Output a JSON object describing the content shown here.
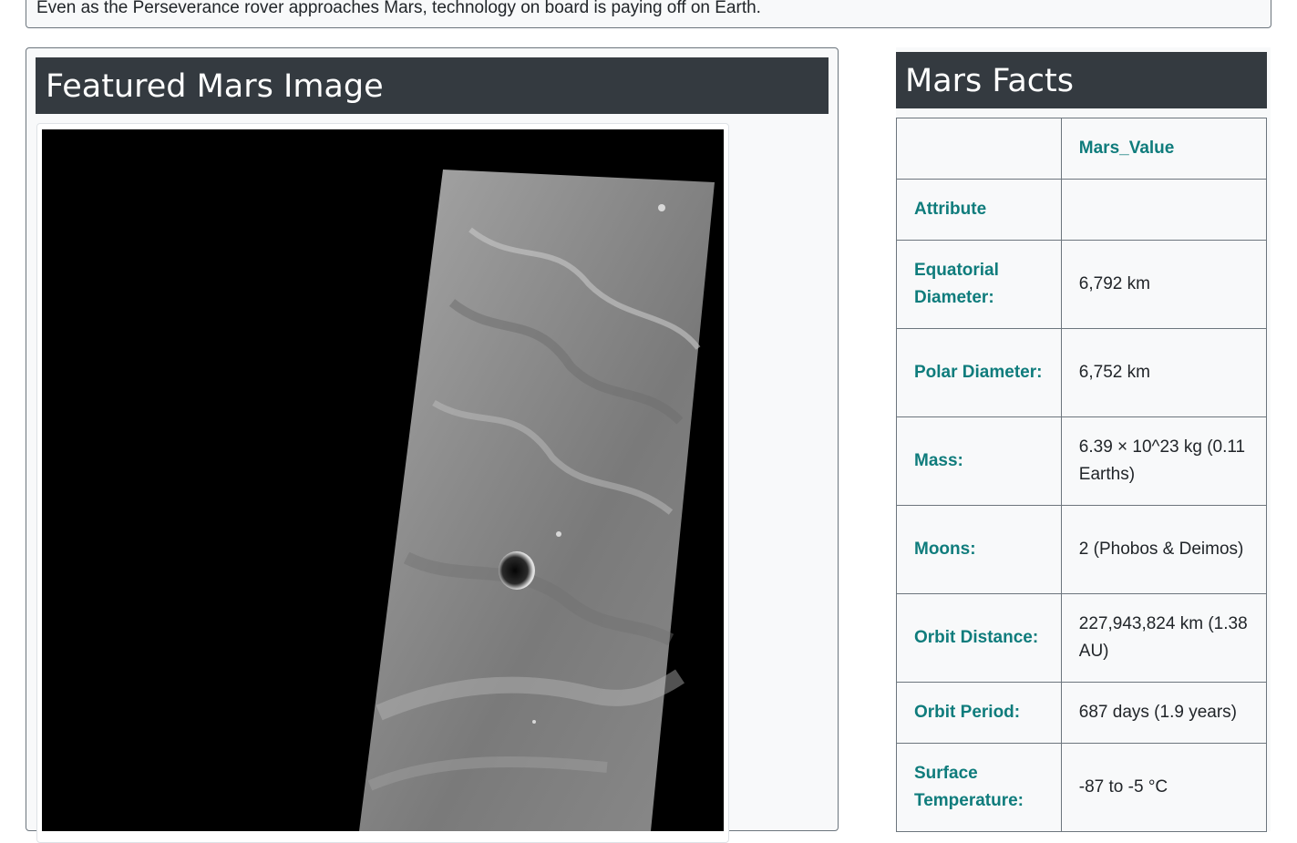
{
  "news": {
    "paragraph": "Even as the Perseverance rover approaches Mars, technology on board is paying off on Earth."
  },
  "featured_image": {
    "title": "Featured Mars Image"
  },
  "facts": {
    "title": "Mars Facts",
    "header": [
      "",
      "Mars_Value"
    ],
    "rows": [
      {
        "attribute": "Attribute",
        "value": ""
      },
      {
        "attribute": "Equatorial Diameter:",
        "value": "6,792 km"
      },
      {
        "attribute": "Polar Diameter:",
        "value": "6,752 km"
      },
      {
        "attribute": "Mass:",
        "value": "6.39 × 10^23 kg (0.11 Earths)"
      },
      {
        "attribute": "Moons:",
        "value": "2 (Phobos & Deimos)"
      },
      {
        "attribute": "Orbit Distance:",
        "value": "227,943,824 km (1.38 AU)"
      },
      {
        "attribute": "Orbit Period:",
        "value": "687 days (1.9 years)"
      },
      {
        "attribute": "Surface Temperature:",
        "value": "-87 to -5 °C"
      }
    ]
  },
  "colors": {
    "header_bg": "#343a40",
    "attribute_text": "#0f7c7c",
    "card_bg": "#f8f9fa"
  }
}
